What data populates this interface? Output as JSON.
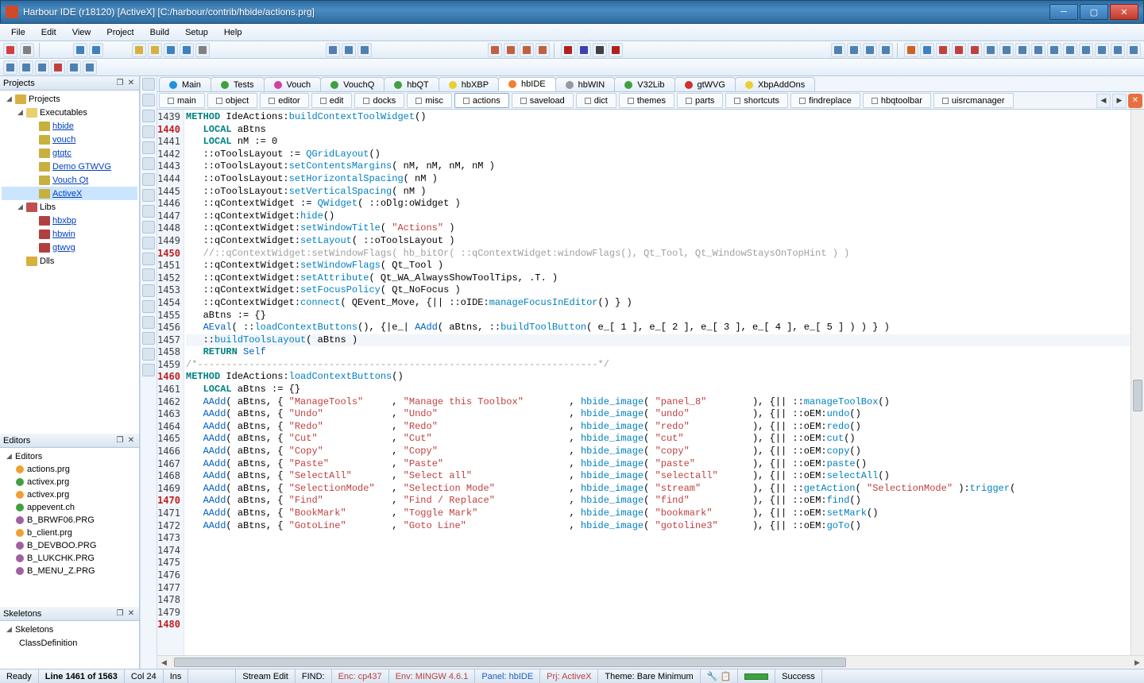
{
  "title": "Harbour IDE (r18120) [ActiveX]   [C:/harbour/contrib/hbide/actions.prg]",
  "menus": [
    "File",
    "Edit",
    "View",
    "Project",
    "Build",
    "Setup",
    "Help"
  ],
  "panels": {
    "projects": {
      "title": "Projects"
    },
    "editors": {
      "title": "Editors"
    },
    "skeletons": {
      "title": "Skeletons"
    }
  },
  "projectTree": [
    {
      "ind": 4,
      "exp": "◢",
      "icon": "#d8b040",
      "label": "Projects"
    },
    {
      "ind": 18,
      "exp": "◢",
      "icon": "#e8d070",
      "label": "Executables"
    },
    {
      "ind": 34,
      "exp": "",
      "icon": "#c8b040",
      "label": "hbide",
      "link": true
    },
    {
      "ind": 34,
      "exp": "",
      "icon": "#c8b040",
      "label": "vouch",
      "link": true
    },
    {
      "ind": 34,
      "exp": "",
      "icon": "#c8b040",
      "label": "gtqtc",
      "link": true
    },
    {
      "ind": 34,
      "exp": "",
      "icon": "#c8b040",
      "label": "Demo GTWVG",
      "link": true
    },
    {
      "ind": 34,
      "exp": "",
      "icon": "#c8b040",
      "label": "Vouch Qt",
      "link": true
    },
    {
      "ind": 34,
      "exp": "",
      "icon": "#c8b040",
      "label": "ActiveX",
      "link": true,
      "sel": true
    },
    {
      "ind": 18,
      "exp": "◢",
      "icon": "#c05050",
      "label": "Libs"
    },
    {
      "ind": 34,
      "exp": "",
      "icon": "#b04040",
      "label": "hbxbp",
      "link": true
    },
    {
      "ind": 34,
      "exp": "",
      "icon": "#b04040",
      "label": "hbwin",
      "link": true
    },
    {
      "ind": 34,
      "exp": "",
      "icon": "#b04040",
      "label": "gtwvg",
      "link": true
    },
    {
      "ind": 18,
      "exp": "",
      "icon": "#d8b040",
      "label": "Dlls"
    }
  ],
  "editorsTree": {
    "root": "Editors",
    "items": [
      {
        "c": "#f0a030",
        "label": "actions.prg"
      },
      {
        "c": "#40a040",
        "label": "activex.prg"
      },
      {
        "c": "#f0a030",
        "label": "activex.prg"
      },
      {
        "c": "#40a040",
        "label": "appevent.ch"
      },
      {
        "c": "#a060a0",
        "label": "B_BRWF06.PRG"
      },
      {
        "c": "#f0a030",
        "label": "b_client.prg"
      },
      {
        "c": "#a060a0",
        "label": "B_DEVBOO.PRG"
      },
      {
        "c": "#a060a0",
        "label": "B_LUKCHK.PRG"
      },
      {
        "c": "#a060a0",
        "label": "B_MENU_Z.PRG"
      }
    ]
  },
  "skeletons": [
    "Skeletons",
    "ClassDefinition"
  ],
  "groupTabs": [
    {
      "c": "#2090e0",
      "label": "Main"
    },
    {
      "c": "#40a040",
      "label": "Tests"
    },
    {
      "c": "#d040a0",
      "label": "Vouch"
    },
    {
      "c": "#40a040",
      "label": "VouchQ"
    },
    {
      "c": "#40a040",
      "label": "hbQT"
    },
    {
      "c": "#e8d030",
      "label": "hbXBP"
    },
    {
      "c": "#f08030",
      "label": "hbIDE",
      "active": true
    },
    {
      "c": "#9898a0",
      "label": "hbWIN"
    },
    {
      "c": "#40a040",
      "label": "V32Lib"
    },
    {
      "c": "#d03030",
      "label": "gtWVG"
    },
    {
      "c": "#e8d030",
      "label": "XbpAddOns"
    }
  ],
  "subTabs": [
    {
      "label": "main"
    },
    {
      "label": "object"
    },
    {
      "label": "editor"
    },
    {
      "label": "edit"
    },
    {
      "label": "docks"
    },
    {
      "label": "misc"
    },
    {
      "label": "actions",
      "active": true
    },
    {
      "label": "saveload"
    },
    {
      "label": "dict"
    },
    {
      "label": "themes"
    },
    {
      "label": "parts"
    },
    {
      "label": "shortcuts"
    },
    {
      "label": "findreplace"
    },
    {
      "label": "hbqtoolbar"
    },
    {
      "label": "uisrcmanager"
    }
  ],
  "lineNumbers": [
    {
      "n": 1439
    },
    {
      "n": 1440,
      "r": true
    },
    {
      "n": 1441
    },
    {
      "n": 1442
    },
    {
      "n": 1443
    },
    {
      "n": 1444
    },
    {
      "n": 1445
    },
    {
      "n": 1446
    },
    {
      "n": 1447
    },
    {
      "n": 1448
    },
    {
      "n": 1449
    },
    {
      "n": 1450,
      "r": true
    },
    {
      "n": 1451
    },
    {
      "n": 1452
    },
    {
      "n": 1453
    },
    {
      "n": 1454
    },
    {
      "n": 1455
    },
    {
      "n": 1456
    },
    {
      "n": 1457
    },
    {
      "n": 1458
    },
    {
      "n": 1459
    },
    {
      "n": 1460,
      "r": true
    },
    {
      "n": 1461
    },
    {
      "n": 1462
    },
    {
      "n": 1463
    },
    {
      "n": 1464
    },
    {
      "n": 1465
    },
    {
      "n": 1466
    },
    {
      "n": 1467
    },
    {
      "n": 1468
    },
    {
      "n": 1469
    },
    {
      "n": 1470,
      "r": true
    },
    {
      "n": 1471
    },
    {
      "n": 1472
    },
    {
      "n": 1473
    },
    {
      "n": 1474
    },
    {
      "n": 1475
    },
    {
      "n": 1476
    },
    {
      "n": 1477
    },
    {
      "n": 1478
    },
    {
      "n": 1479
    },
    {
      "n": 1480,
      "r": true
    }
  ],
  "code": [
    [
      [
        "k1",
        "METHOD "
      ],
      [
        "op",
        "IdeActions:"
      ],
      [
        "fn",
        "buildContextToolWidget"
      ],
      [
        "op",
        "()"
      ]
    ],
    [
      [
        "op",
        "   "
      ],
      [
        "k1",
        "LOCAL "
      ],
      [
        "op",
        "aBtns"
      ]
    ],
    [
      [
        "op",
        "   "
      ],
      [
        "k1",
        "LOCAL "
      ],
      [
        "op",
        "nM := 0"
      ]
    ],
    [
      [
        "op",
        ""
      ]
    ],
    [
      [
        "op",
        "   ::oToolsLayout := "
      ],
      [
        "fn",
        "QGridLayout"
      ],
      [
        "op",
        "()"
      ]
    ],
    [
      [
        "op",
        "   ::oToolsLayout:"
      ],
      [
        "fn",
        "setContentsMargins"
      ],
      [
        "op",
        "( nM, nM, nM, nM )"
      ]
    ],
    [
      [
        "op",
        "   ::oToolsLayout:"
      ],
      [
        "fn",
        "setHorizontalSpacing"
      ],
      [
        "op",
        "( nM )"
      ]
    ],
    [
      [
        "op",
        "   ::oToolsLayout:"
      ],
      [
        "fn",
        "setVerticalSpacing"
      ],
      [
        "op",
        "( nM )"
      ]
    ],
    [
      [
        "op",
        ""
      ]
    ],
    [
      [
        "op",
        "   ::qContextWidget := "
      ],
      [
        "fn",
        "QWidget"
      ],
      [
        "op",
        "( ::oDlg:oWidget )"
      ]
    ],
    [
      [
        "op",
        "   ::qContextWidget:"
      ],
      [
        "fn",
        "hide"
      ],
      [
        "op",
        "()"
      ]
    ],
    [
      [
        "op",
        "   ::qContextWidget:"
      ],
      [
        "fn",
        "setWindowTitle"
      ],
      [
        "op",
        "( "
      ],
      [
        "str",
        "\"Actions\""
      ],
      [
        "op",
        " )"
      ]
    ],
    [
      [
        "op",
        "   ::qContextWidget:"
      ],
      [
        "fn",
        "setLayout"
      ],
      [
        "op",
        "( ::oToolsLayout )"
      ]
    ],
    [
      [
        "cmt",
        "   //::qContextWidget:setWindowFlags( hb_bitOr( ::qContextWidget:windowFlags(), Qt_Tool, Qt_WindowStaysOnTopHint ) )"
      ]
    ],
    [
      [
        "op",
        "   ::qContextWidget:"
      ],
      [
        "fn",
        "setWindowFlags"
      ],
      [
        "op",
        "( Qt_Tool )"
      ]
    ],
    [
      [
        "op",
        "   ::qContextWidget:"
      ],
      [
        "fn",
        "setAttribute"
      ],
      [
        "op",
        "( Qt_WA_AlwaysShowToolTips, .T. )"
      ]
    ],
    [
      [
        "op",
        "   ::qContextWidget:"
      ],
      [
        "fn",
        "setFocusPolicy"
      ],
      [
        "op",
        "( Qt_NoFocus )"
      ]
    ],
    [
      [
        "op",
        "   ::qContextWidget:"
      ],
      [
        "fn",
        "connect"
      ],
      [
        "op",
        "( QEvent_Move, {|| ::oIDE:"
      ],
      [
        "fn",
        "manageFocusInEditor"
      ],
      [
        "op",
        "() } )"
      ]
    ],
    [
      [
        "op",
        ""
      ]
    ],
    [
      [
        "op",
        "   aBtns := {}"
      ]
    ],
    [
      [
        "op",
        "   "
      ],
      [
        "k2",
        "AEval"
      ],
      [
        "op",
        "( ::"
      ],
      [
        "fn",
        "loadContextButtons"
      ],
      [
        "op",
        "(), {|e_| "
      ],
      [
        "k2",
        "AAdd"
      ],
      [
        "op",
        "( aBtns, ::"
      ],
      [
        "fn",
        "buildToolButton"
      ],
      [
        "op",
        "( e_[ 1 ], e_[ 2 ], e_[ 3 ], e_[ 4 ], e_[ 5 ] ) ) } )"
      ]
    ],
    [
      [
        "op",
        ""
      ]
    ],
    [
      [
        "op",
        "   ::"
      ],
      [
        "fn",
        "buildToolsLayout"
      ],
      [
        "op",
        "( aBtns )"
      ]
    ],
    [
      [
        "op",
        ""
      ]
    ],
    [
      [
        "op",
        "   "
      ],
      [
        "k1",
        "RETURN "
      ],
      [
        "k2",
        "Self"
      ]
    ],
    [
      [
        "op",
        ""
      ]
    ],
    [
      [
        "cmt",
        "/*----------------------------------------------------------------------*/"
      ]
    ],
    [
      [
        "op",
        ""
      ]
    ],
    [
      [
        "k1",
        "METHOD "
      ],
      [
        "op",
        "IdeActions:"
      ],
      [
        "fn",
        "loadContextButtons"
      ],
      [
        "op",
        "()"
      ]
    ],
    [
      [
        "op",
        "   "
      ],
      [
        "k1",
        "LOCAL "
      ],
      [
        "op",
        "aBtns := {}"
      ]
    ],
    [
      [
        "op",
        ""
      ]
    ],
    [
      [
        "op",
        "   "
      ],
      [
        "k2",
        "AAdd"
      ],
      [
        "op",
        "( aBtns, { "
      ],
      [
        "str",
        "\"ManageTools\""
      ],
      [
        "op",
        "     , "
      ],
      [
        "str",
        "\"Manage this Toolbox\""
      ],
      [
        "op",
        "        , "
      ],
      [
        "fn",
        "hbide_image"
      ],
      [
        "op",
        "( "
      ],
      [
        "str",
        "\"panel_8\""
      ],
      [
        "op",
        "        ), {|| ::"
      ],
      [
        "fn",
        "manageToolBox"
      ],
      [
        "op",
        "()"
      ]
    ],
    [
      [
        "op",
        "   "
      ],
      [
        "k2",
        "AAdd"
      ],
      [
        "op",
        "( aBtns, { "
      ],
      [
        "str",
        "\"Undo\""
      ],
      [
        "op",
        "            , "
      ],
      [
        "str",
        "\"Undo\""
      ],
      [
        "op",
        "                       , "
      ],
      [
        "fn",
        "hbide_image"
      ],
      [
        "op",
        "( "
      ],
      [
        "str",
        "\"undo\""
      ],
      [
        "op",
        "           ), {|| ::oEM:"
      ],
      [
        "fn",
        "undo"
      ],
      [
        "op",
        "()"
      ]
    ],
    [
      [
        "op",
        "   "
      ],
      [
        "k2",
        "AAdd"
      ],
      [
        "op",
        "( aBtns, { "
      ],
      [
        "str",
        "\"Redo\""
      ],
      [
        "op",
        "            , "
      ],
      [
        "str",
        "\"Redo\""
      ],
      [
        "op",
        "                       , "
      ],
      [
        "fn",
        "hbide_image"
      ],
      [
        "op",
        "( "
      ],
      [
        "str",
        "\"redo\""
      ],
      [
        "op",
        "           ), {|| ::oEM:"
      ],
      [
        "fn",
        "redo"
      ],
      [
        "op",
        "()"
      ]
    ],
    [
      [
        "op",
        "   "
      ],
      [
        "k2",
        "AAdd"
      ],
      [
        "op",
        "( aBtns, { "
      ],
      [
        "str",
        "\"Cut\""
      ],
      [
        "op",
        "             , "
      ],
      [
        "str",
        "\"Cut\""
      ],
      [
        "op",
        "                        , "
      ],
      [
        "fn",
        "hbide_image"
      ],
      [
        "op",
        "( "
      ],
      [
        "str",
        "\"cut\""
      ],
      [
        "op",
        "            ), {|| ::oEM:"
      ],
      [
        "fn",
        "cut"
      ],
      [
        "op",
        "()"
      ]
    ],
    [
      [
        "op",
        "   "
      ],
      [
        "k2",
        "AAdd"
      ],
      [
        "op",
        "( aBtns, { "
      ],
      [
        "str",
        "\"Copy\""
      ],
      [
        "op",
        "            , "
      ],
      [
        "str",
        "\"Copy\""
      ],
      [
        "op",
        "                       , "
      ],
      [
        "fn",
        "hbide_image"
      ],
      [
        "op",
        "( "
      ],
      [
        "str",
        "\"copy\""
      ],
      [
        "op",
        "           ), {|| ::oEM:"
      ],
      [
        "fn",
        "copy"
      ],
      [
        "op",
        "()"
      ]
    ],
    [
      [
        "op",
        "   "
      ],
      [
        "k2",
        "AAdd"
      ],
      [
        "op",
        "( aBtns, { "
      ],
      [
        "str",
        "\"Paste\""
      ],
      [
        "op",
        "           , "
      ],
      [
        "str",
        "\"Paste\""
      ],
      [
        "op",
        "                      , "
      ],
      [
        "fn",
        "hbide_image"
      ],
      [
        "op",
        "( "
      ],
      [
        "str",
        "\"paste\""
      ],
      [
        "op",
        "          ), {|| ::oEM:"
      ],
      [
        "fn",
        "paste"
      ],
      [
        "op",
        "()"
      ]
    ],
    [
      [
        "op",
        "   "
      ],
      [
        "k2",
        "AAdd"
      ],
      [
        "op",
        "( aBtns, { "
      ],
      [
        "str",
        "\"SelectAll\""
      ],
      [
        "op",
        "       , "
      ],
      [
        "str",
        "\"Select all\""
      ],
      [
        "op",
        "                 , "
      ],
      [
        "fn",
        "hbide_image"
      ],
      [
        "op",
        "( "
      ],
      [
        "str",
        "\"selectall\""
      ],
      [
        "op",
        "      ), {|| ::oEM:"
      ],
      [
        "fn",
        "selectAll"
      ],
      [
        "op",
        "()"
      ]
    ],
    [
      [
        "op",
        "   "
      ],
      [
        "k2",
        "AAdd"
      ],
      [
        "op",
        "( aBtns, { "
      ],
      [
        "str",
        "\"SelectionMode\""
      ],
      [
        "op",
        "   , "
      ],
      [
        "str",
        "\"Selection Mode\""
      ],
      [
        "op",
        "             , "
      ],
      [
        "fn",
        "hbide_image"
      ],
      [
        "op",
        "( "
      ],
      [
        "str",
        "\"stream\""
      ],
      [
        "op",
        "         ), {|| ::"
      ],
      [
        "fn",
        "getAction"
      ],
      [
        "op",
        "( "
      ],
      [
        "str",
        "\"SelectionMode\""
      ],
      [
        "op",
        " ):"
      ],
      [
        "fn",
        "trigger"
      ],
      [
        "op",
        "("
      ]
    ],
    [
      [
        "op",
        "   "
      ],
      [
        "k2",
        "AAdd"
      ],
      [
        "op",
        "( aBtns, { "
      ],
      [
        "str",
        "\"Find\""
      ],
      [
        "op",
        "            , "
      ],
      [
        "str",
        "\"Find / Replace\""
      ],
      [
        "op",
        "             , "
      ],
      [
        "fn",
        "hbide_image"
      ],
      [
        "op",
        "( "
      ],
      [
        "str",
        "\"find\""
      ],
      [
        "op",
        "           ), {|| ::oEM:"
      ],
      [
        "fn",
        "find"
      ],
      [
        "op",
        "()"
      ]
    ],
    [
      [
        "op",
        "   "
      ],
      [
        "k2",
        "AAdd"
      ],
      [
        "op",
        "( aBtns, { "
      ],
      [
        "str",
        "\"BookMark\""
      ],
      [
        "op",
        "        , "
      ],
      [
        "str",
        "\"Toggle Mark\""
      ],
      [
        "op",
        "                , "
      ],
      [
        "fn",
        "hbide_image"
      ],
      [
        "op",
        "( "
      ],
      [
        "str",
        "\"bookmark\""
      ],
      [
        "op",
        "       ), {|| ::oEM:"
      ],
      [
        "fn",
        "setMark"
      ],
      [
        "op",
        "()"
      ]
    ],
    [
      [
        "op",
        "   "
      ],
      [
        "k2",
        "AAdd"
      ],
      [
        "op",
        "( aBtns, { "
      ],
      [
        "str",
        "\"GotoLine\""
      ],
      [
        "op",
        "        , "
      ],
      [
        "str",
        "\"Goto Line\""
      ],
      [
        "op",
        "                  , "
      ],
      [
        "fn",
        "hbide_image"
      ],
      [
        "op",
        "( "
      ],
      [
        "str",
        "\"gotoline3\""
      ],
      [
        "op",
        "      ), {|| ::oEM:"
      ],
      [
        "fn",
        "goTo"
      ],
      [
        "op",
        "()"
      ]
    ]
  ],
  "currentLine": 22,
  "status": {
    "ready": "Ready",
    "line": "Line 1461 of 1563",
    "col": "Col 24",
    "ins": "Ins",
    "mode": "Stream  Edit",
    "find": "FIND:",
    "enc": "Enc: cp437",
    "env": "Env: MINGW 4.6.1",
    "panel": "Panel: hbIDE",
    "prj": "Prj: ActiveX",
    "theme": "Theme: Bare Minimum",
    "success": "Success"
  }
}
